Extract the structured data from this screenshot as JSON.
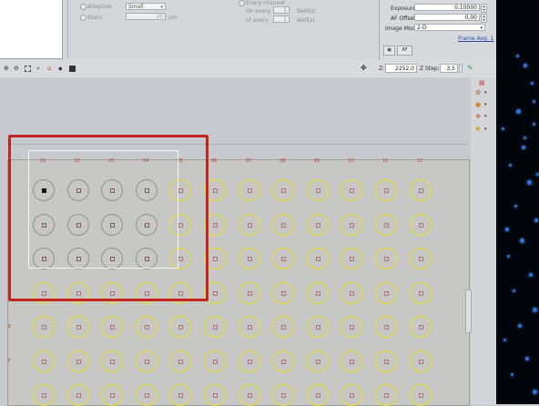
{
  "acquisition": {
    "adaptive_label": "Adaptive",
    "adaptive_value": "Small",
    "static_label": "Static",
    "static_value": "20",
    "static_unit": "µm",
    "every_channel_label": "Every channel",
    "on_every_label": "On every",
    "on_every_value": "1",
    "on_every_unit": "field(s)",
    "of_every_label": "of every",
    "of_every_value": "1",
    "of_every_unit": "well(s)"
  },
  "settings": {
    "exposure_label": "Exposure:",
    "exposure_value": "0,10000",
    "af_offset_label": "AF Offset:",
    "af_offset_value": "0,00",
    "image_mode_label": "Image Mode:",
    "image_mode_value": "2-D",
    "frame_avg_link": "Frame Avg: 1",
    "af_button": "AF"
  },
  "toolbar": {
    "z_label": "Z:",
    "z_value": "2252,0",
    "z_step_label": "Z Step:",
    "z_step_value": "3,5"
  },
  "plate": {
    "columns": [
      "01",
      "02",
      "03",
      "04",
      "05",
      "06",
      "07",
      "08",
      "09",
      "10",
      "11",
      "12"
    ],
    "rows": [
      "E",
      "F"
    ],
    "selected_well": "A01"
  },
  "colors": {
    "highlight_box": "#c2261f",
    "well_available": "#e7e01f",
    "well_in_region": "#8e9092",
    "label_red": "#c0392b"
  }
}
